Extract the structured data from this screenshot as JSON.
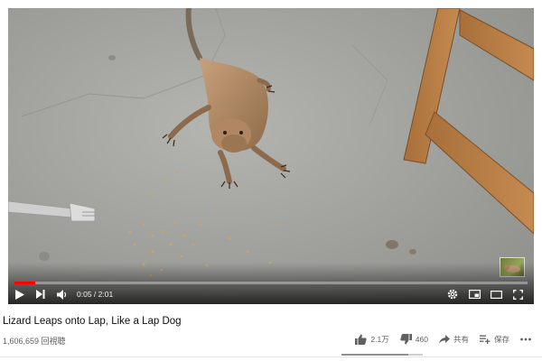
{
  "video": {
    "title": "Lizard Leaps onto Lap, Like a Lap Dog",
    "views": "1,606,659 回視聴",
    "progress_fraction": 0.041
  },
  "player": {
    "current_time": "0:05",
    "duration": "2:01",
    "time_display": "0:05 / 2:01",
    "icons": [
      "play-icon",
      "next-icon",
      "volume-icon",
      "settings-icon",
      "miniplayer-icon",
      "theater-icon",
      "fullscreen-icon"
    ]
  },
  "actions": {
    "like_count": "2.1万",
    "dislike_count": "460",
    "share_label": "共有",
    "save_label": "保存",
    "like_ratio": 0.82
  },
  "colors": {
    "progress": "#ff0000",
    "text_primary": "#0d0d0d",
    "text_secondary": "#606060"
  }
}
